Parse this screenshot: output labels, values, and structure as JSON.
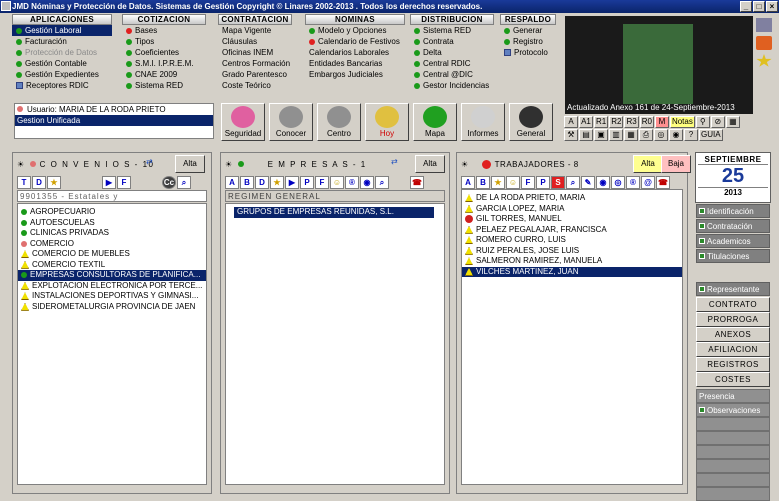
{
  "window": {
    "title": "JMD Nóminas y Protección de Datos. Sistemas de Gestión     Copyright © Linares 2002-2013 .  Todos los derechos reservados."
  },
  "menus": [
    {
      "title": "APLICACIONES",
      "items": [
        {
          "label": "Gestión Laboral",
          "dot": "g",
          "sel": true
        },
        {
          "label": "Facturación",
          "dot": "g"
        },
        {
          "label": "Protección de Datos",
          "dot": "g",
          "dis": true
        },
        {
          "label": "Gestión Contable",
          "dot": "g"
        },
        {
          "label": "Gestión Expedientes",
          "dot": "g"
        },
        {
          "label": "Receptores RDIC",
          "dot": "sq"
        }
      ]
    },
    {
      "title": "COTIZACION",
      "items": [
        {
          "label": "Bases",
          "dot": "r"
        },
        {
          "label": "Tipos",
          "dot": "g"
        },
        {
          "label": "Coeficientes",
          "dot": "g"
        },
        {
          "label": "S.M.I.  I.P.R.E.M.",
          "dot": "g"
        },
        {
          "label": "CNAE 2009",
          "dot": "g"
        },
        {
          "label": "Sistema RED",
          "dot": "g"
        }
      ]
    },
    {
      "title": "CONTRATACION",
      "items": [
        {
          "label": "Mapa Vigente"
        },
        {
          "label": "Cláusulas"
        },
        {
          "label": "Oficinas INEM"
        },
        {
          "label": "Centros Formación"
        },
        {
          "label": "Grado Parentesco"
        },
        {
          "label": "Coste Teórico"
        }
      ]
    },
    {
      "title": "NOMINAS",
      "items": [
        {
          "label": "Modelo y Opciones",
          "dot": "g"
        },
        {
          "label": "Calendario de Festivos",
          "dot": "r"
        },
        {
          "label": "Calendarios Laborales"
        },
        {
          "label": "Entidades Bancarias"
        },
        {
          "label": "Embargos Judiciales"
        }
      ]
    },
    {
      "title": "DISTRIBUCION",
      "items": [
        {
          "label": "Sistema RED",
          "dot": "g"
        },
        {
          "label": "Contrata",
          "dot": "g"
        },
        {
          "label": "Delta",
          "dot": "g"
        },
        {
          "label": "Central  RDIC",
          "dot": "g"
        },
        {
          "label": "Central  @DIC",
          "dot": "g"
        },
        {
          "label": "Gestor Incidencias",
          "dot": "g"
        }
      ]
    },
    {
      "title": "RESPALDO",
      "items": [
        {
          "label": "Generar",
          "dot": "g"
        },
        {
          "label": "Registro",
          "dot": "g"
        },
        {
          "label": "Protocolo",
          "dot": "sq"
        }
      ]
    }
  ],
  "news": {
    "caption": "Actualizado Anexo 161 de 24-Septiembre-2013"
  },
  "user": {
    "line1": "Usuario: MARIA DE LA RODA PRIETO",
    "line2": "Gestion Unificada"
  },
  "bigbuttons": [
    {
      "label": "Seguridad"
    },
    {
      "label": "Conocer"
    },
    {
      "label": "Centro"
    },
    {
      "label": "Hoy"
    },
    {
      "label": "Mapa"
    },
    {
      "label": "Informes"
    },
    {
      "label": "General"
    }
  ],
  "letters1": [
    "A",
    "A1",
    "R1",
    "R2",
    "R3",
    "R0",
    "M",
    "Notas"
  ],
  "letters2": [
    "GUIA"
  ],
  "convenios": {
    "title": "C O N V E N I O S - 10",
    "alta": "Alta",
    "filter": "9901355 - Estatales y",
    "items": [
      "AGROPECUARIO",
      "AUTOESCUELAS",
      "CLINICAS PRIVADAS",
      "COMERCIO",
      "COMERCIO DE MUEBLES",
      "COMERCIO TEXTIL",
      "EMPRESAS CONSULTORAS DE PLANIFICA...",
      "EXPLOTACION ELECTRONICA POR TERCE...",
      "INSTALACIONES DEPORTIVAS Y GIMNASI...",
      "SIDEROMETALURGIA PROVINCIA DE JAEN"
    ]
  },
  "empresas": {
    "title": "E M P R E S A S - 1",
    "alta": "Alta",
    "header": "REGIMEN GENERAL",
    "items": [
      "GRUPOS DE EMPRESAS REUNIDAS, S.L."
    ]
  },
  "trabajadores": {
    "title": "TRABAJADORES - 8",
    "alta": "Alta",
    "baja": "Baja",
    "items": [
      "DE LA RODA PRIETO, MARIA",
      "GARCIA LOPEZ, MARIA",
      "GIL TORRES, MANUEL",
      "PELAEZ PEGALAJAR, FRANCISCA",
      "ROMERO CURRO, LUIS",
      "RUIZ PERALES, JOSE LUIS",
      "SALMERON RAMIREZ, MANUELA",
      "VILCHES MARTINEZ, JUAN"
    ]
  },
  "calendar": {
    "month": "SEPTIEMBRE",
    "day": "25",
    "year": "2013"
  },
  "side1": [
    "Identificación",
    "Contratación",
    "Academicos",
    "Titulaciones"
  ],
  "side2": "Representante",
  "side3": [
    "CONTRATO",
    "PRORROGA",
    "ANEXOS",
    "AFILIACION",
    "REGISTROS",
    "COSTES"
  ],
  "side4": [
    "Presencia",
    "Observaciones"
  ]
}
